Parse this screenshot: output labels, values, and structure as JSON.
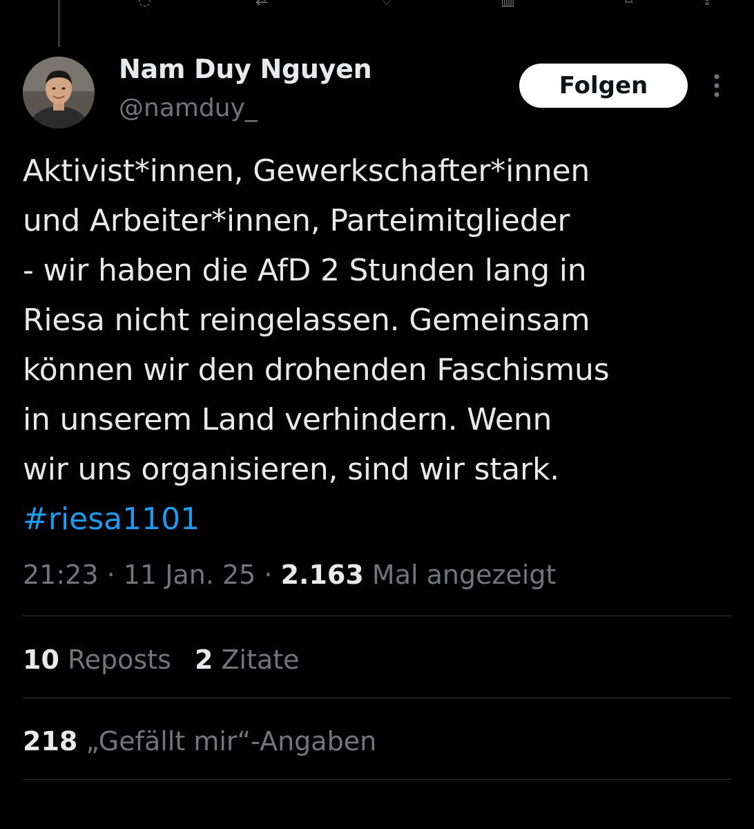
{
  "author": {
    "name": "Nam Duy Nguyen",
    "handle": "@namduy_"
  },
  "follow_button": {
    "label": "Folgen"
  },
  "tweet": {
    "text": "Aktivist*innen, Gewerkschafter*innen\nund Arbeiter*innen,  Parteimitglieder\n- wir haben die AfD 2 Stunden lang in\nRiesa nicht  reingelassen. Gemeinsam\nkönnen wir den drohenden Faschismus\nin unserem Land verhindern. Wenn\nwir uns organisieren, sind wir stark.",
    "hashtag": "#riesa1101"
  },
  "meta": {
    "time": "21:23",
    "separator": "·",
    "date": "11 Jan. 25",
    "views_count": "2.163",
    "views_label": "Mal angezeigt"
  },
  "stats": {
    "reposts_count": "10",
    "reposts_label": "Reposts",
    "quotes_count": "2",
    "quotes_label": "Zitate",
    "likes_count": "218",
    "likes_label": "„Gefällt mir“-Angaben"
  },
  "colors": {
    "background": "#000000",
    "text_primary": "#e7e9ea",
    "text_secondary": "#71767b",
    "link": "#1d9bf0",
    "divider": "#2f3336",
    "button_bg": "#ffffff"
  },
  "icons": {
    "top_strip": [
      "reply-icon",
      "repost-icon",
      "like-icon",
      "views-icon",
      "bookmark-icon",
      "share-icon"
    ],
    "more": "more-vertical-icon"
  }
}
